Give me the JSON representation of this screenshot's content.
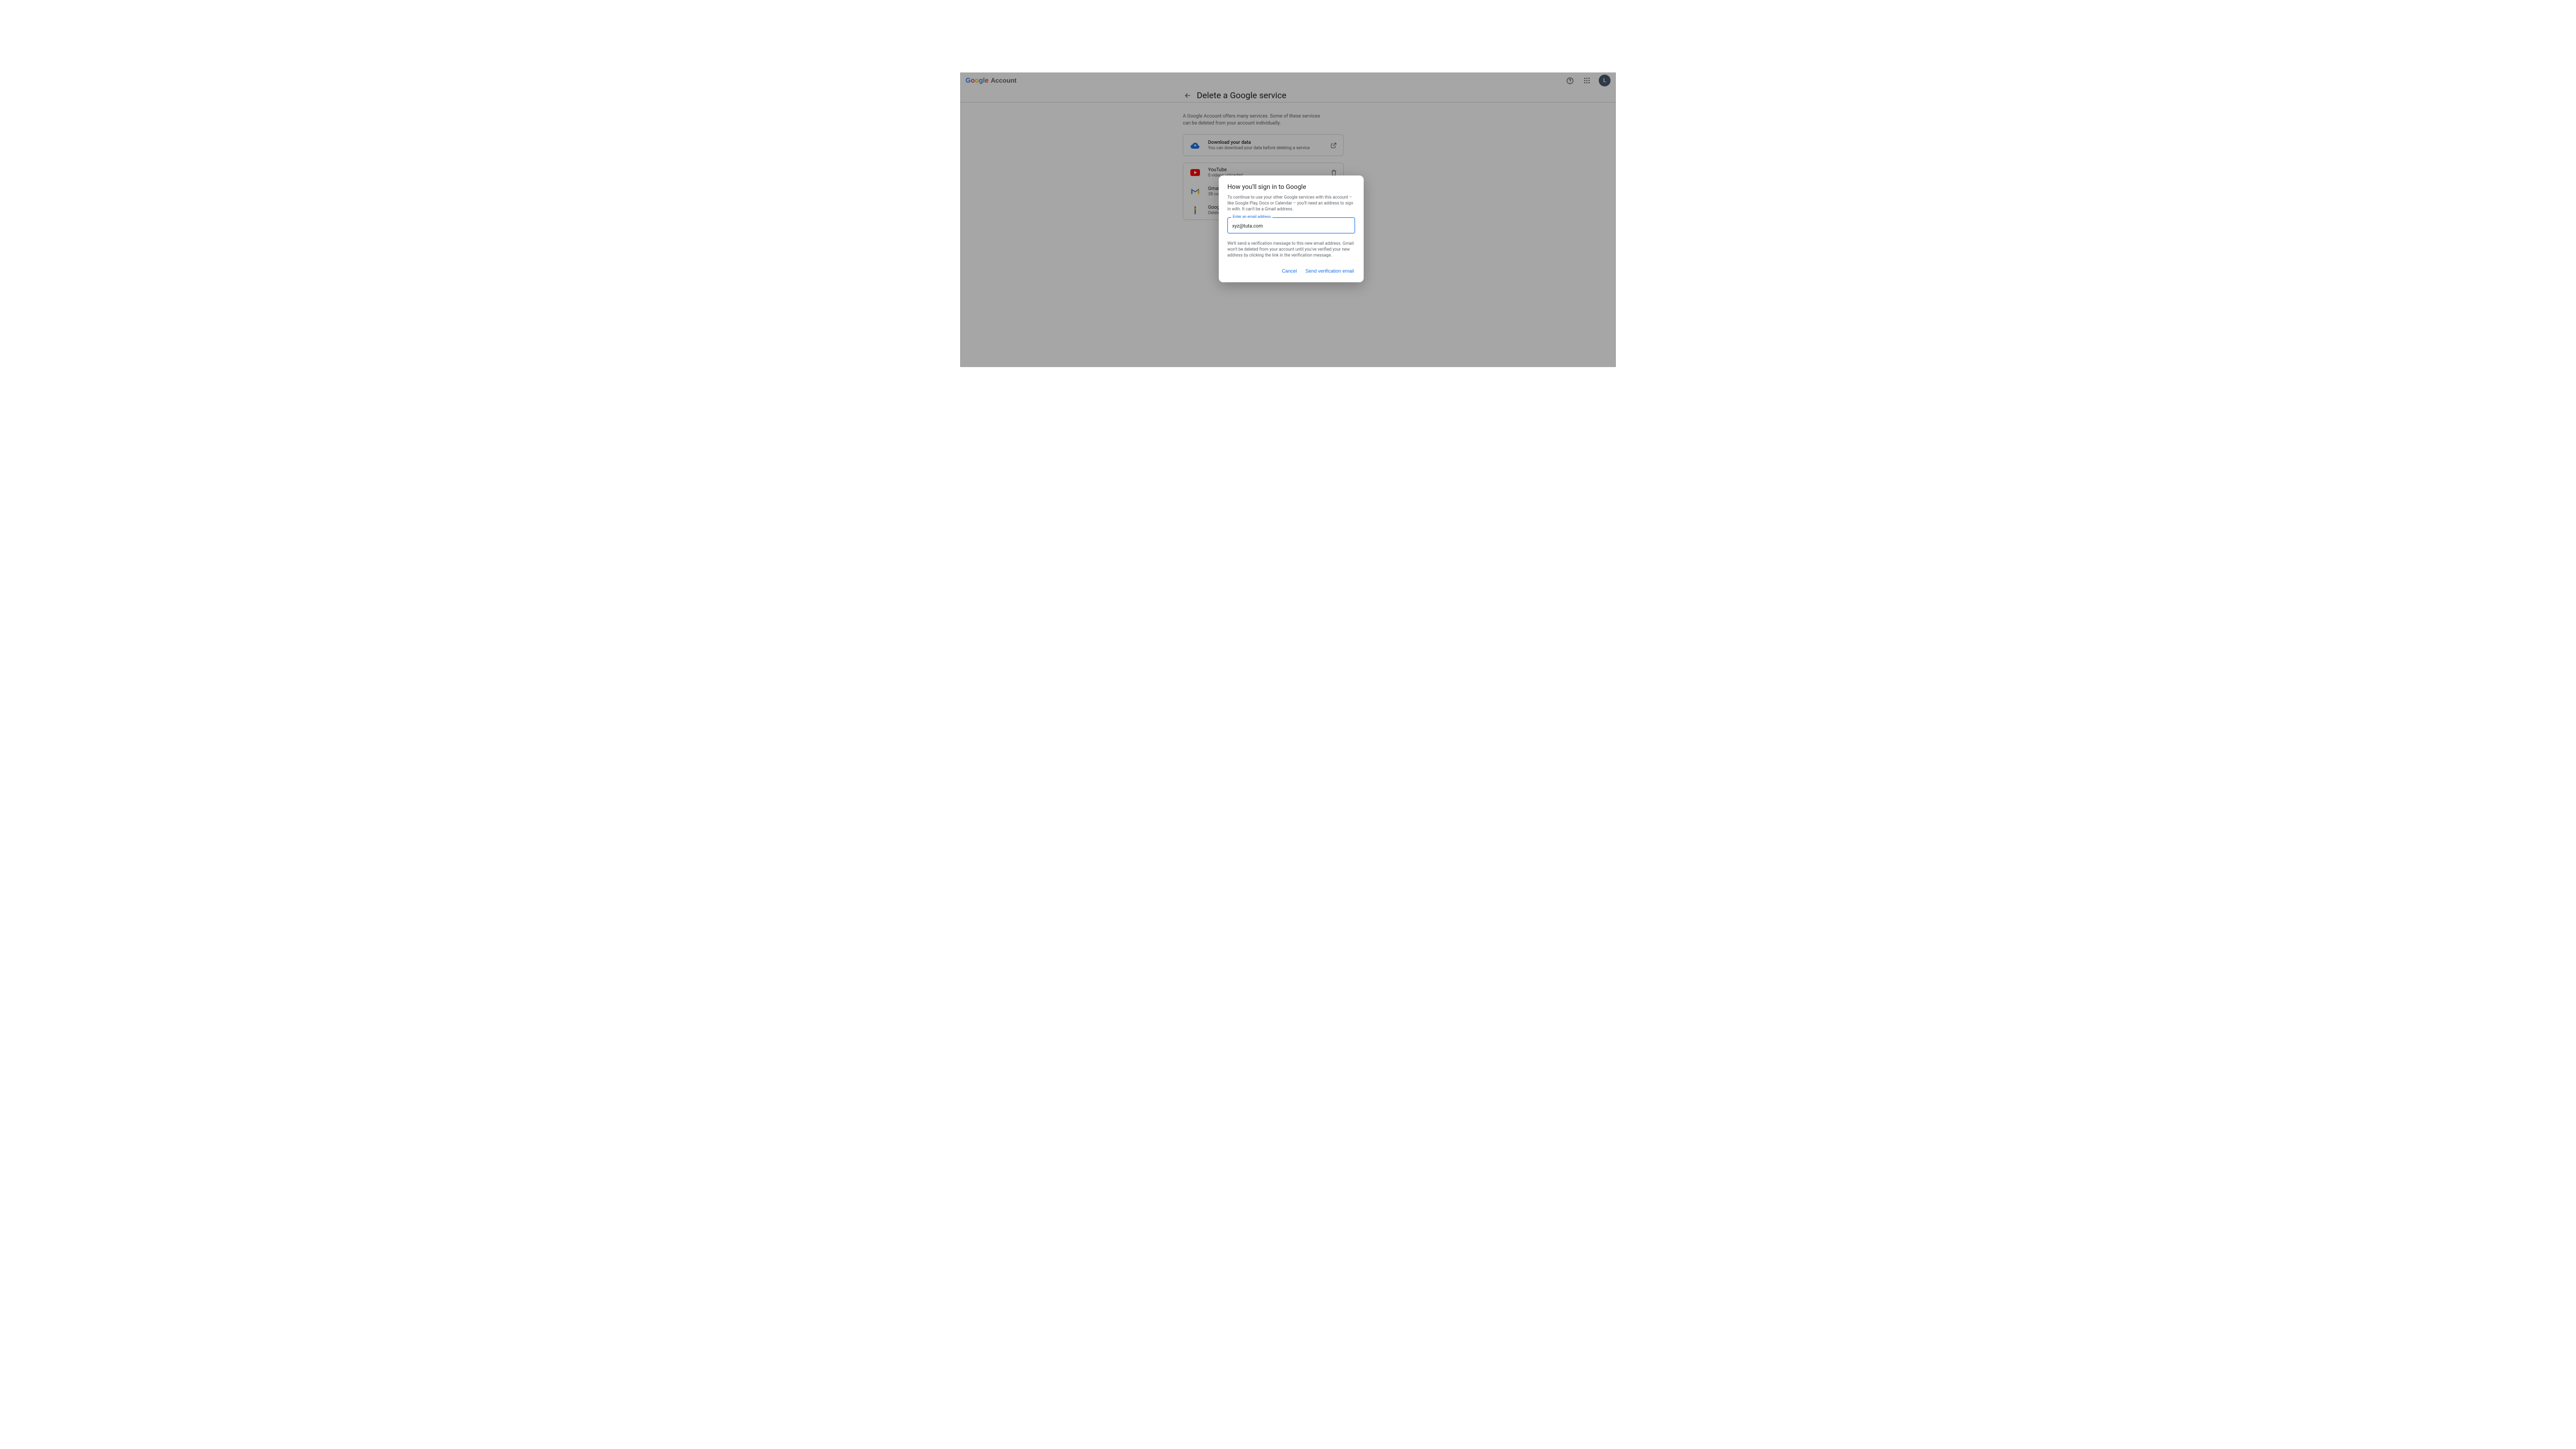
{
  "header": {
    "logo_letters": [
      "G",
      "o",
      "o",
      "g",
      "l",
      "e"
    ],
    "product": "Account",
    "avatar_letter": "L"
  },
  "page": {
    "title": "Delete a Google service",
    "intro": "A Google Account offers many services. Some of these services can be de­leted from your account individually."
  },
  "download_card": {
    "title": "Download your data",
    "subtitle": "You can download your data before deleting a service"
  },
  "services": [
    {
      "name": "YouTube",
      "subtitle": "0 videos uploaded"
    },
    {
      "name": "Gmail",
      "subtitle": "38 con"
    },
    {
      "name": "Google",
      "subtitle": "Delete y"
    }
  ],
  "dialog": {
    "title": "How you'll sign in to Google",
    "body": "To continue to use your other Google services with this account – like Google Play, Docs or Calendar – you'll need an address to sign in with. It can't be a Gmail address.",
    "field_label": "Enter an email address",
    "field_value": "xyz@tuta.com",
    "note": "We'll send a verification message to this new email address. Gmail won't be deleted from your account until you've verified your new address by clicking the link in the verification message.",
    "cancel": "Cancel",
    "send": "Send verification email"
  }
}
